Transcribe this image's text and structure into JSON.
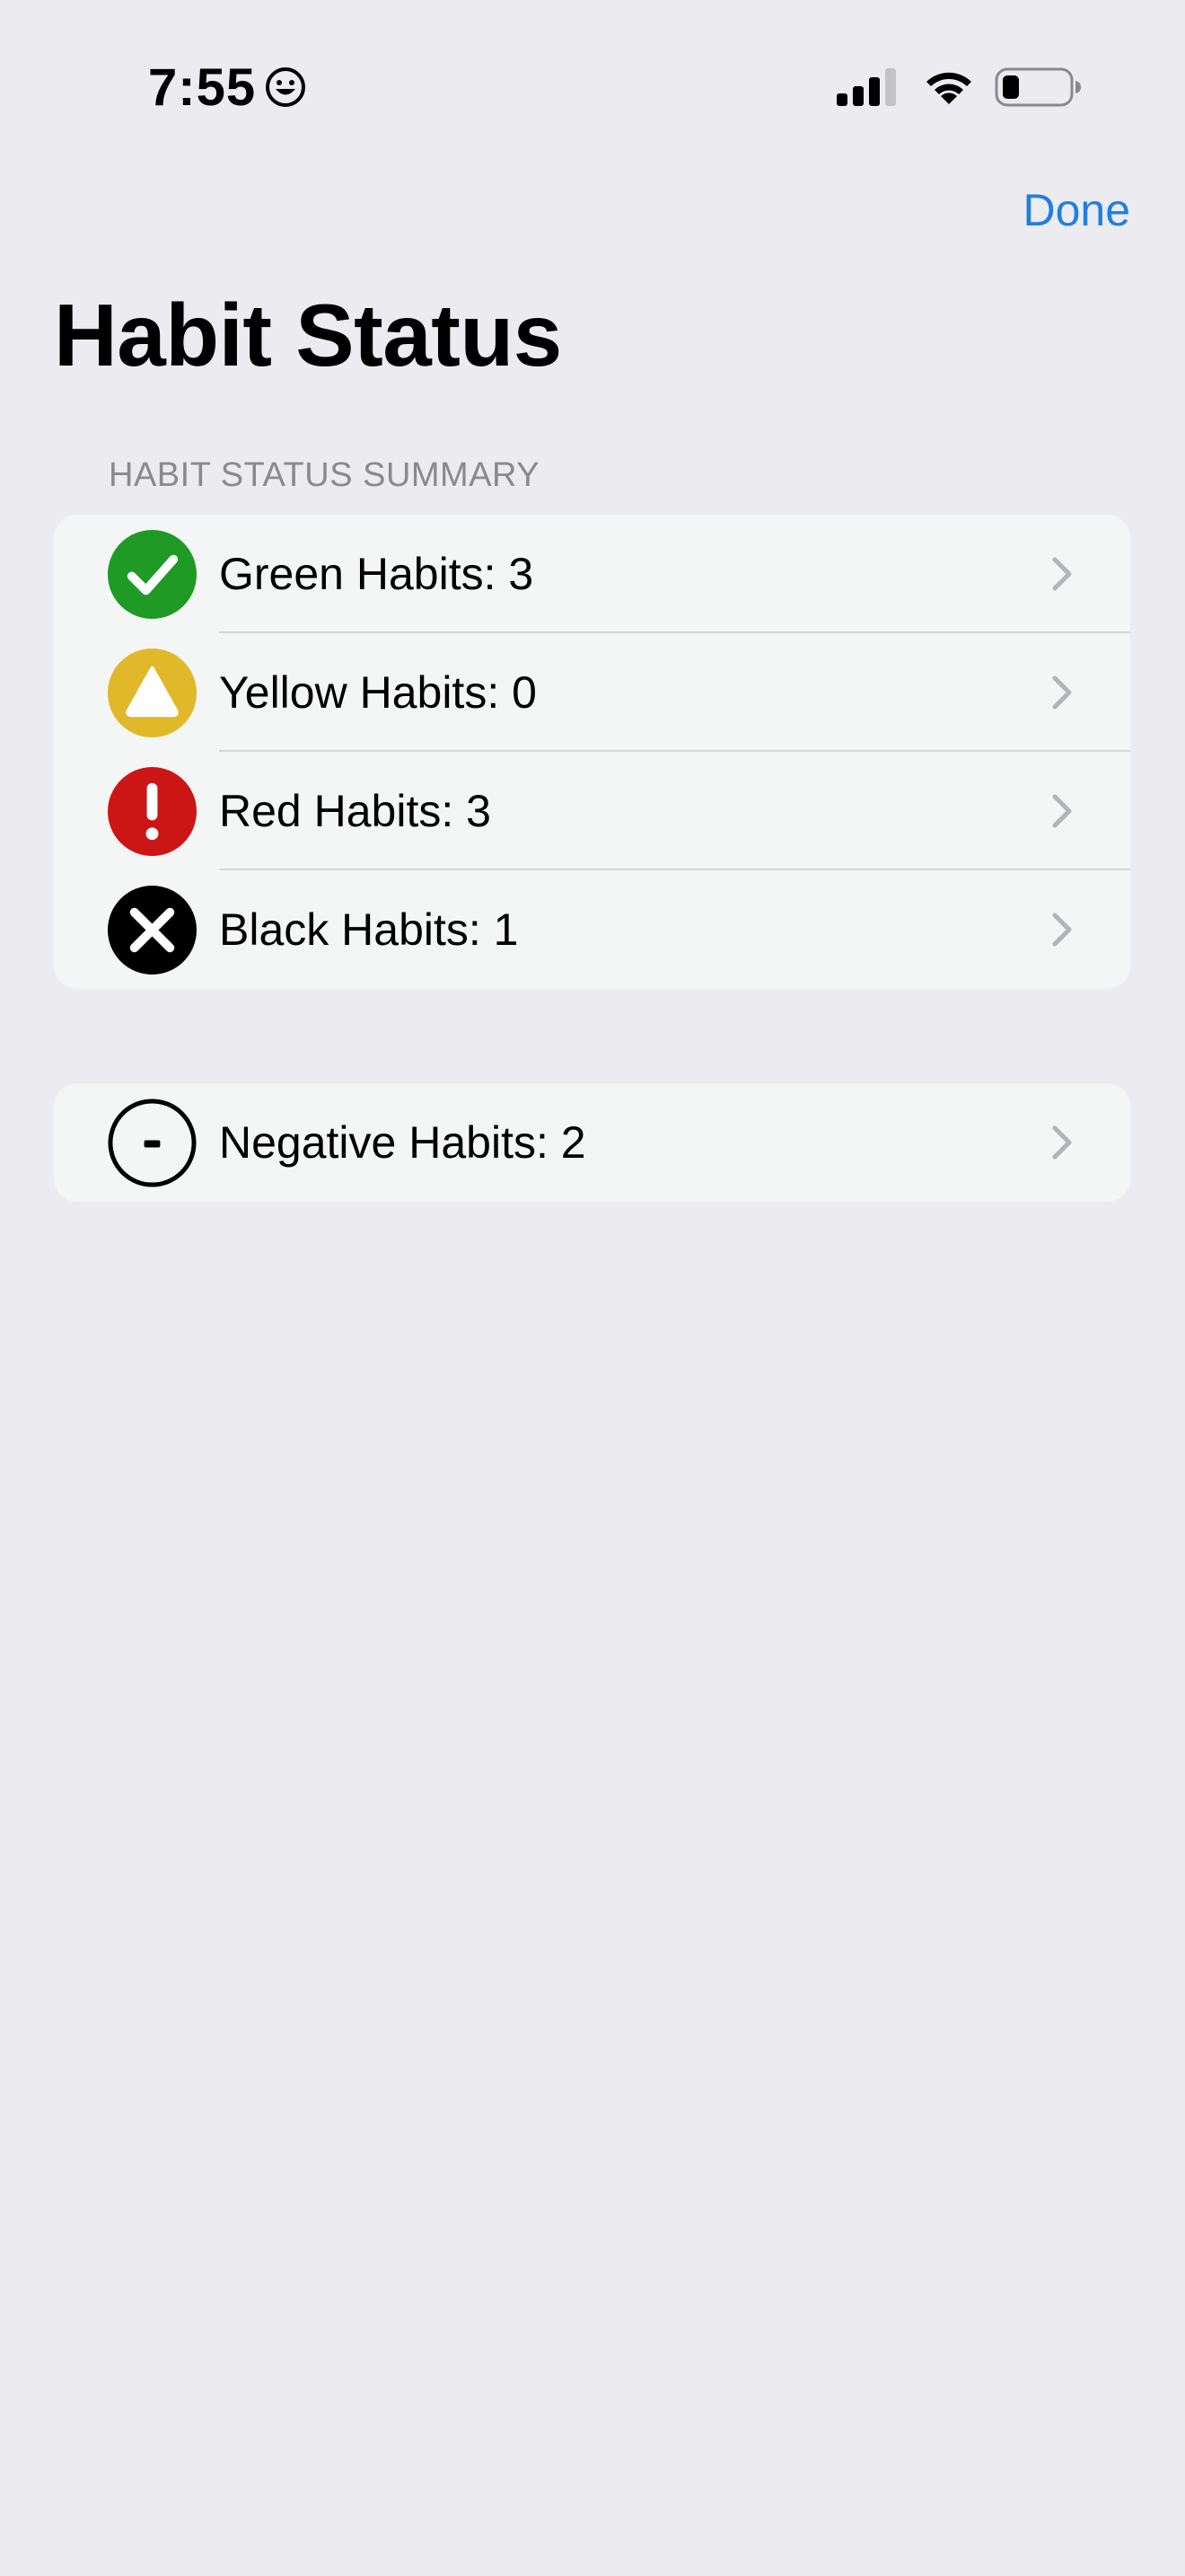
{
  "status_bar": {
    "time": "7:55",
    "smiley_icon": "smiley-face-icon",
    "signal_icon": "cellular-signal-icon",
    "wifi_icon": "wifi-icon",
    "battery_icon": "battery-icon",
    "battery_level": 0.2
  },
  "nav": {
    "done_label": "Done",
    "title": "Habit Status"
  },
  "summary_section": {
    "header": "HABIT STATUS SUMMARY",
    "items": [
      {
        "label": "Green Habits: 3",
        "icon": "green-check-icon",
        "color": "#1f9a24"
      },
      {
        "label": "Yellow Habits: 0",
        "icon": "yellow-triangle-icon",
        "color": "#e0b82a"
      },
      {
        "label": "Red Habits: 3",
        "icon": "red-exclamation-icon",
        "color": "#cc1515"
      },
      {
        "label": "Black Habits: 1",
        "icon": "black-x-icon",
        "color": "#000000"
      }
    ]
  },
  "negative_section": {
    "items": [
      {
        "label": "Negative Habits: 2",
        "icon": "negative-minus-icon",
        "color": "#000000"
      }
    ]
  },
  "colors": {
    "background": "#ebebf0",
    "card": "#f4f5f5",
    "accent": "#1f7fe0",
    "secondary_text": "#8a8a8e",
    "chevron": "#b4b4b8"
  }
}
